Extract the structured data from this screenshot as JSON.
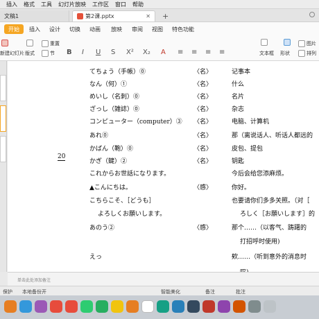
{
  "menubar": {
    "items": [
      "插入",
      "格式",
      "工具",
      "幻灯片放映",
      "工作区",
      "窗口",
      "帮助"
    ]
  },
  "tabs": {
    "doc1": "文稿1",
    "doc2": "第2课.pptx",
    "plus": "+"
  },
  "ribbon": {
    "start": "开始",
    "tabs": [
      "插入",
      "设计",
      "切换",
      "动画",
      "放映",
      "审阅",
      "视图",
      "特色功能"
    ]
  },
  "toolbar": {
    "new_slide": "新建幻灯片",
    "layout": "版式",
    "reset": "重置",
    "section": "节",
    "bold": "B",
    "italic": "I",
    "underline": "U",
    "text_box": "文本框",
    "shape": "形状",
    "picture": "图片",
    "arrange": "排列"
  },
  "slide": {
    "lesson_num": "20",
    "rows": [
      {
        "jp": "てちょう（手帳）⓪",
        "tag": "〈名〉",
        "cn": "记事本"
      },
      {
        "jp": "なん（何）①",
        "tag": "〈名〉",
        "cn": "什么"
      },
      {
        "jp": "めいし（名刺）⓪",
        "tag": "〈名〉",
        "cn": "名片"
      },
      {
        "jp": "ざっし（雑誌）⓪",
        "tag": "〈名〉",
        "cn": "杂志"
      },
      {
        "jp": "コンピューター（computer）③",
        "tag": "〈名〉",
        "cn": "电脑、计算机"
      },
      {
        "jp": "あれ⓪",
        "tag": "〈名〉",
        "cn": "那（离说话人、听话人都远的"
      },
      {
        "jp": "かばん（鞄）⓪",
        "tag": "〈名〉",
        "cn": "皮包、提包"
      },
      {
        "jp": "かぎ（鍵）②",
        "tag": "〈名〉",
        "cn": "钥匙"
      },
      {
        "jp": "これからお世話になります。",
        "tag": "",
        "cn": "今后会给您添麻烦。"
      },
      {
        "jp": "▲こんにちは。",
        "tag": "〈感〉",
        "cn": "你好。"
      },
      {
        "jp": "こちらこそ、［どうも］",
        "tag": "",
        "cn": "也要请你们多多关照。（对［"
      },
      {
        "jp": "よろしくお願いします。",
        "tag": "",
        "cn": "ろしく［お願いします］的"
      },
      {
        "jp": "あのう②",
        "tag": "〈感〉",
        "cn": "那个……（以客气、踌躇的"
      },
      {
        "jp": "",
        "tag": "",
        "cn": "打招呼时使用)"
      },
      {
        "jp": "えっ",
        "tag": "",
        "cn": "欸……（听到意外的消息时"
      },
      {
        "jp": "",
        "tag": "",
        "cn": "叹)"
      }
    ]
  },
  "notes": {
    "placeholder": "单击此处添加备注"
  },
  "statusbar": {
    "protect": "保护",
    "backup": "本地备份开",
    "beautify": "智能美化",
    "notes": "备注",
    "comments": "批注"
  }
}
